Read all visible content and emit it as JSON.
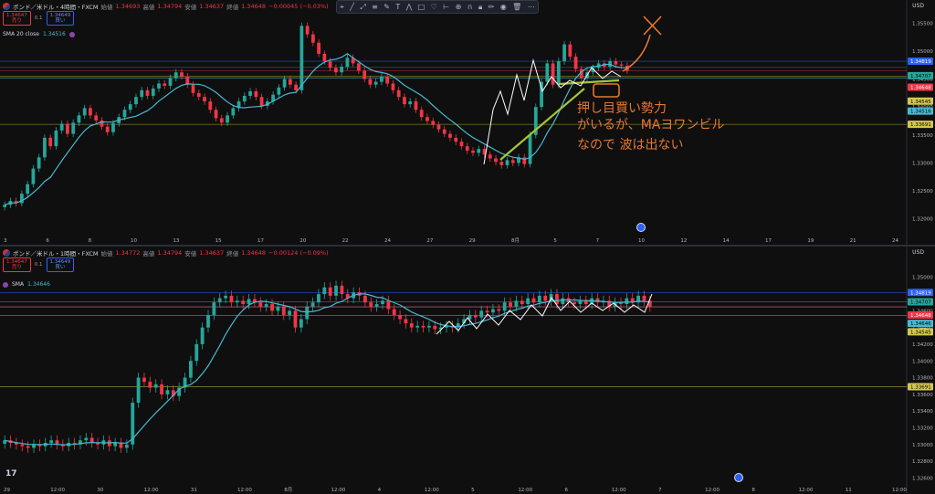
{
  "pane1": {
    "legend": {
      "symbol": "ポンド／米ドル・4時間・FXCM",
      "open_label": "始値",
      "open": "1.34693",
      "high_label": "高値",
      "high": "1.34794",
      "low_label": "安値",
      "low": "1.34637",
      "close_label": "終値",
      "close": "1.34648",
      "change": "−0.00045 (−0.03%)"
    },
    "trade": {
      "sell_price": "1.34647",
      "sell_label": "売り",
      "spread": "0.1",
      "buy_price": "1.34649",
      "buy_label": "買い"
    },
    "sma": {
      "label": "SMA 20 close",
      "value": "1.34516"
    },
    "currency": "USD",
    "annotation": {
      "line1": "押し目買い勢力",
      "line2": "がいるが、MAヨワンビル",
      "line3": "なので 波は出ない"
    }
  },
  "pane2": {
    "legend": {
      "symbol": "ポンド／米ドル・1時間・FXCM",
      "open_label": "始値",
      "open": "1.34772",
      "high_label": "高値",
      "high": "1.34794",
      "low_label": "安値",
      "low": "1.34637",
      "close_label": "終値",
      "close": "1.34648",
      "change": "−0.00124 (−0.09%)"
    },
    "trade": {
      "sell_price": "1.34647",
      "sell_label": "売り",
      "spread": "0.1",
      "buy_price": "1.34649",
      "buy_label": "買い"
    },
    "sma": {
      "label": "SMA",
      "value": "1.34646"
    },
    "currency": "USD"
  },
  "toolbar_icons": [
    "cursor-icon",
    "line-icon",
    "trend-icon",
    "fib-icon",
    "brush-icon",
    "text-icon",
    "pattern-icon",
    "rect-icon",
    "heart-icon",
    "ruler-icon",
    "zoom-icon",
    "magnet-icon",
    "lock-icon",
    "pencil-icon",
    "eye-icon",
    "trash-icon",
    "more-icon"
  ],
  "colors": {
    "up": "#26a69a",
    "down": "#f23645",
    "sma": "#49b8d1",
    "annotation": "#e8772e",
    "green_line": "#a4c639",
    "level_yellow": "#d4c84c",
    "level_blue": "#2962ff"
  },
  "chart_data": [
    {
      "type": "candlestick",
      "title": "ポンド／米ドル・4時間・FXCM",
      "y_ticks": [
        "1.35500",
        "1.35000",
        "1.34500",
        "1.34000",
        "1.33500",
        "1.33000",
        "1.32500",
        "1.32000"
      ],
      "ylim": [
        1.3175,
        1.3575
      ],
      "x_ticks": [
        "3",
        "6",
        "8",
        "10",
        "13",
        "15",
        "17",
        "20",
        "22",
        "24",
        "27",
        "29",
        "8月",
        "5",
        "7",
        "10",
        "12",
        "14",
        "17",
        "19",
        "21",
        "24"
      ],
      "closes": [
        1.3225,
        1.3232,
        1.3228,
        1.3245,
        1.3262,
        1.329,
        1.331,
        1.3345,
        1.333,
        1.3358,
        1.337,
        1.3352,
        1.3372,
        1.3385,
        1.3398,
        1.3385,
        1.3376,
        1.3365,
        1.3355,
        1.3371,
        1.3382,
        1.3395,
        1.3405,
        1.3418,
        1.343,
        1.342,
        1.3433,
        1.3442,
        1.3438,
        1.3452,
        1.3462,
        1.3455,
        1.344,
        1.3425,
        1.3418,
        1.341,
        1.3395,
        1.338,
        1.3372,
        1.3385,
        1.3398,
        1.341,
        1.342,
        1.3428,
        1.3418,
        1.3402,
        1.341,
        1.3422,
        1.3435,
        1.345,
        1.344,
        1.343,
        1.3545,
        1.353,
        1.3515,
        1.3495,
        1.3482,
        1.347,
        1.3462,
        1.3472,
        1.3488,
        1.3478,
        1.3465,
        1.345,
        1.344,
        1.3445,
        1.3455,
        1.3442,
        1.343,
        1.3418,
        1.3405,
        1.341,
        1.3395,
        1.3382,
        1.3375,
        1.3368,
        1.336,
        1.3352,
        1.3345,
        1.3338,
        1.333,
        1.3322,
        1.3318,
        1.3325,
        1.3315,
        1.3308,
        1.3302,
        1.3296,
        1.3305,
        1.33,
        1.331,
        1.3298,
        1.335,
        1.34,
        1.3445,
        1.3478,
        1.344,
        1.3482,
        1.3512,
        1.349,
        1.3468,
        1.3452,
        1.3462,
        1.347,
        1.3478,
        1.3472,
        1.3482,
        1.3476,
        1.3474,
        1.3465
      ],
      "sma_value": 1.34516,
      "levels": [
        {
          "price": 1.34819,
          "label": "1.34819",
          "color": "#2962ff"
        },
        {
          "price": 1.34707,
          "label": "1.34707",
          "color": "#26a69a"
        },
        {
          "price": 1.34648,
          "label": "GBPUSD 1.34648 02:07:48",
          "color": "#f23645"
        },
        {
          "price": 1.34545,
          "label": "1.34545",
          "color": "#d4c84c"
        },
        {
          "price": 1.34516,
          "label": "1.34516",
          "color": "#49b8d1"
        },
        {
          "price": 1.33691,
          "label": "1.33691",
          "color": "#d4c84c"
        }
      ]
    },
    {
      "type": "candlestick",
      "title": "ポンド／米ドル・1時間・FXCM",
      "y_ticks": [
        "1.35000",
        "1.34800",
        "1.34600",
        "1.34400",
        "1.34200",
        "1.34000",
        "1.33800",
        "1.33600",
        "1.33400",
        "1.33200",
        "1.33000",
        "1.32800",
        "1.32600"
      ],
      "ylim": [
        1.3255,
        1.3515
      ],
      "x_ticks": [
        "29",
        "12:00",
        "30",
        "12:00",
        "31",
        "12:00",
        "8月",
        "12:00",
        "4",
        "12:00",
        "5",
        "12:00",
        "6",
        "12:00",
        "7",
        "12:00",
        "8",
        "12:00",
        "11",
        "12:00"
      ],
      "closes": [
        1.3305,
        1.3302,
        1.33,
        1.3298,
        1.3296,
        1.33,
        1.3298,
        1.3302,
        1.3305,
        1.33,
        1.3298,
        1.3302,
        1.33,
        1.3305,
        1.3308,
        1.3302,
        1.33,
        1.3305,
        1.3298,
        1.3302,
        1.3296,
        1.33,
        1.335,
        1.338,
        1.3375,
        1.3368,
        1.3372,
        1.336,
        1.3365,
        1.3358,
        1.3368,
        1.338,
        1.34,
        1.342,
        1.344,
        1.3455,
        1.347,
        1.3475,
        1.3478,
        1.347,
        1.3472,
        1.3468,
        1.3474,
        1.347,
        1.3465,
        1.3468,
        1.346,
        1.3465,
        1.3455,
        1.346,
        1.344,
        1.345,
        1.3465,
        1.347,
        1.348,
        1.3488,
        1.3478,
        1.349,
        1.348,
        1.3475,
        1.3482,
        1.3478,
        1.347,
        1.3465,
        1.3468,
        1.3472,
        1.3462,
        1.3455,
        1.345,
        1.3445,
        1.344,
        1.3442,
        1.344,
        1.3442,
        1.3438,
        1.344,
        1.3442,
        1.344,
        1.3445,
        1.345,
        1.3455,
        1.3452,
        1.346,
        1.3458,
        1.3462,
        1.346,
        1.347,
        1.3465,
        1.3472,
        1.3468,
        1.3475,
        1.347,
        1.3478,
        1.3472,
        1.348,
        1.3468,
        1.3475,
        1.347,
        1.3468,
        1.3472,
        1.3468,
        1.3475,
        1.347,
        1.3472,
        1.3465,
        1.347,
        1.3468,
        1.3475,
        1.347,
        1.3478,
        1.3472,
        1.3465
      ],
      "sma_value": 1.34646,
      "levels": [
        {
          "price": 1.34819,
          "label": "1.34819",
          "color": "#2962ff"
        },
        {
          "price": 1.34707,
          "label": "1.34707",
          "color": "#26a69a"
        },
        {
          "price": 1.34648,
          "label": "GBPUSD 1.34648 07:48",
          "color": "#f23645"
        },
        {
          "price": 1.34646,
          "label": "1.34646",
          "color": "#49b8d1"
        },
        {
          "price": 1.34545,
          "label": "1.34545",
          "color": "#d4c84c"
        },
        {
          "price": 1.33691,
          "label": "1.33691",
          "color": "#d4c84c"
        }
      ]
    }
  ]
}
